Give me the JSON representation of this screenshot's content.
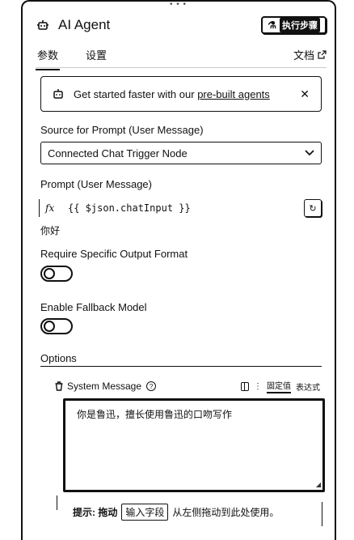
{
  "header": {
    "title": "AI Agent",
    "exec_button_label": "执行步骤"
  },
  "tabs": [
    {
      "label": "参数",
      "active": true
    },
    {
      "label": "设置",
      "active": false
    }
  ],
  "docs_link": "文档",
  "banner": {
    "prefix": "Get started faster with our ",
    "link": "pre-built agents"
  },
  "source_field": {
    "label": "Source for Prompt (User Message)",
    "value": "Connected Chat Trigger Node"
  },
  "prompt_field": {
    "label": "Prompt (User Message)",
    "fx": "fx",
    "expression": "{{ $json.chatInput }}",
    "result": "你好"
  },
  "require_format": {
    "label": "Require Specific Output Format",
    "enabled": false
  },
  "fallback_model": {
    "label": "Enable Fallback Model",
    "enabled": false
  },
  "options": {
    "label": "Options",
    "system_message": {
      "label": "System Message",
      "mode_fixed": "固定值",
      "mode_expression": "表达式",
      "value": "你是鲁迅，擅长使用鲁迅的口吻写作"
    }
  },
  "hint": {
    "prefix": "提示: 拖动",
    "chip": "输入字段",
    "suffix": "从左侧拖动到此处使用。"
  }
}
